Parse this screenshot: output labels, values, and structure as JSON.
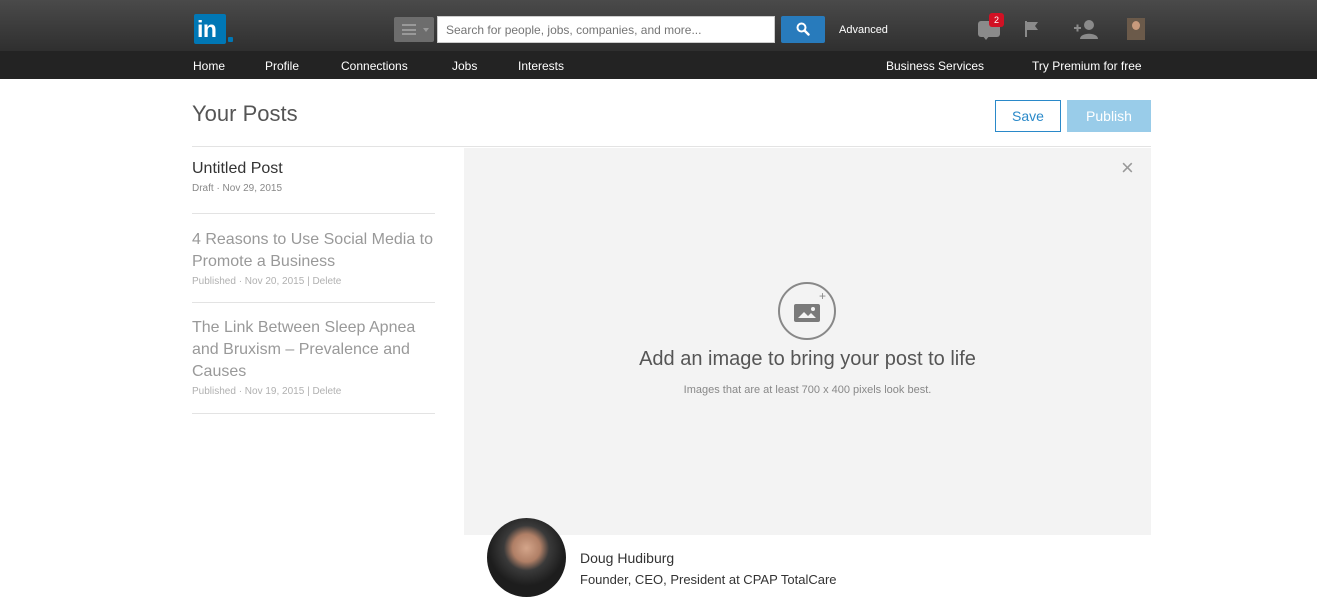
{
  "topbar": {
    "logo": "in",
    "search_placeholder": "Search for people, jobs, companies, and more...",
    "advanced_label": "Advanced",
    "messages_badge": "2",
    "icons": [
      "menu-icon",
      "search-icon",
      "messages-icon",
      "flag-icon",
      "add-connection-icon",
      "profile-photo"
    ]
  },
  "nav": {
    "items": [
      "Home",
      "Profile",
      "Connections",
      "Jobs",
      "Interests"
    ],
    "business_services": "Business Services",
    "try_premium": "Try Premium for free"
  },
  "page": {
    "title": "Your Posts",
    "save_label": "Save",
    "publish_label": "Publish"
  },
  "posts": [
    {
      "title": "Untitled Post",
      "meta": "Draft · Nov 29, 2015"
    },
    {
      "title": "4 Reasons to Use Social Media to Promote a Business",
      "meta": "Published · Nov 20, 2015 | Delete"
    },
    {
      "title": "The Link Between Sleep Apnea and Bruxism – Prevalence and Causes",
      "meta": "Published · Nov 19, 2015 | Delete"
    }
  ],
  "editor": {
    "close_symbol": "×",
    "image_prompt": "Add an image to bring your post to life",
    "image_hint": "Images that are at least 700 x 400 pixels look best."
  },
  "author": {
    "name": "Doug Hudiburg",
    "headline": "Founder, CEO, President at CPAP TotalCare"
  },
  "colors": {
    "brand_blue": "#0077b5",
    "search_button": "#287bbc",
    "publish_disabled": "#99cce9",
    "badge_red": "#d11124"
  }
}
